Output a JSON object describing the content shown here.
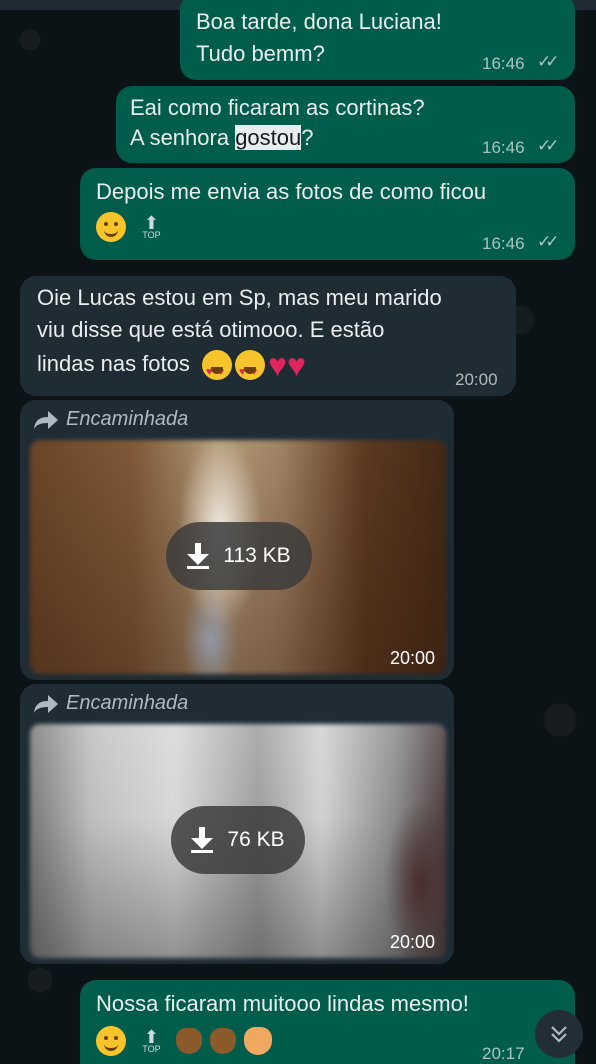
{
  "messages": {
    "m1": {
      "line1": "Boa tarde, dona Luciana!",
      "line2": "Tudo bemm?",
      "time": "16:46"
    },
    "m2": {
      "line1": "Eai como ficaram as cortinas?",
      "line2_pre": "A senhora ",
      "line2_highlight": "gostou",
      "line2_post": "?",
      "time": "16:46"
    },
    "m3": {
      "line1": "Depois me envia as fotos de como ficou",
      "time": "16:46",
      "top_label": "TOP"
    },
    "m4": {
      "line1": "Oie Lucas estou em Sp, mas meu marido",
      "line2": "viu disse que está otimooo. E estão",
      "line3": "lindas nas fotos",
      "time": "20:00"
    },
    "m5": {
      "forwarded_label": "Encaminhada",
      "size": "113 KB",
      "time": "20:00"
    },
    "m6": {
      "forwarded_label": "Encaminhada",
      "size": "76 KB",
      "time": "20:00"
    },
    "m7": {
      "line1": "Nossa ficaram muitooo lindas mesmo!",
      "time": "20:17",
      "top_label": "TOP"
    }
  },
  "icons": {
    "read_ticks": "double-check-icon",
    "forward": "forward-arrow-icon",
    "download": "download-icon",
    "scroll_down": "double-chevron-down-icon"
  },
  "colors": {
    "background": "#0c1317",
    "outgoing_bubble": "#005c4b",
    "incoming_bubble": "#1f2c34"
  }
}
